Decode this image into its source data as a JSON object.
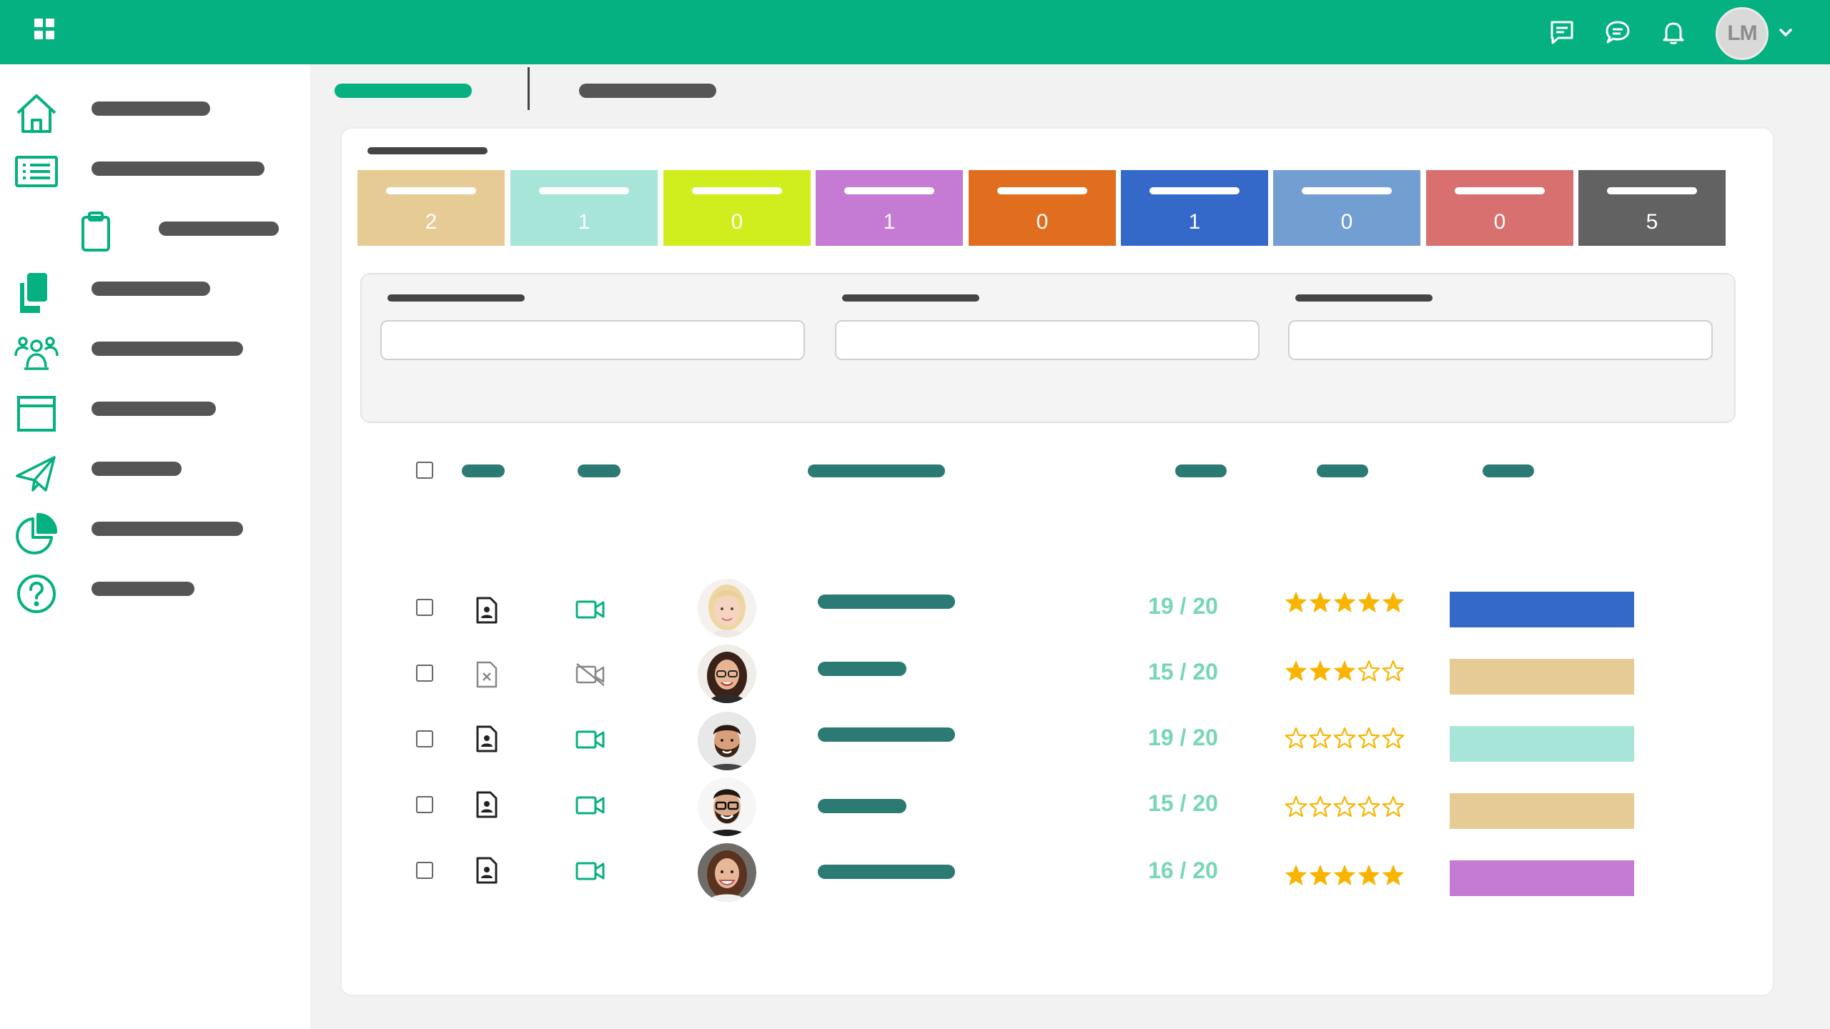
{
  "header": {
    "icons": [
      "apps-grid-icon",
      "feedback-icon",
      "chat-icon",
      "bell-icon",
      "chevron-down-icon"
    ],
    "avatar_initials": "LM",
    "brand_color": "#05b081"
  },
  "sidebar": {
    "items": [
      {
        "icon": "home-icon",
        "label": ""
      },
      {
        "icon": "list-icon",
        "label": ""
      },
      {
        "icon": "clipboard-icon",
        "label": ""
      },
      {
        "icon": "copy-icon",
        "label": ""
      },
      {
        "icon": "team-icon",
        "label": ""
      },
      {
        "icon": "browser-window-icon",
        "label": ""
      },
      {
        "icon": "send-icon",
        "label": ""
      },
      {
        "icon": "pie-chart-icon",
        "label": ""
      },
      {
        "icon": "help-icon",
        "label": ""
      }
    ]
  },
  "tabs": [
    {
      "label": "",
      "active": true
    },
    {
      "label": "",
      "active": false
    }
  ],
  "card": {
    "title": "",
    "statuses": [
      {
        "label": "",
        "count": "2",
        "color": "#e6cb95"
      },
      {
        "label": "",
        "count": "1",
        "color": "#a7e5d8"
      },
      {
        "label": "",
        "count": "0",
        "color": "#d0ed1e"
      },
      {
        "label": "",
        "count": "1",
        "color": "#c57ad3"
      },
      {
        "label": "",
        "count": "0",
        "color": "#e06e1e"
      },
      {
        "label": "",
        "count": "1",
        "color": "#3469ca"
      },
      {
        "label": "",
        "count": "0",
        "color": "#739ed2"
      },
      {
        "label": "",
        "count": "0",
        "color": "#d97070"
      },
      {
        "label": "",
        "count": "5",
        "color": "#626262"
      }
    ],
    "filters": [
      {
        "label": "",
        "value": ""
      },
      {
        "label": "",
        "value": ""
      },
      {
        "label": "",
        "value": ""
      }
    ],
    "table": {
      "headers": [
        "",
        "",
        "",
        "",
        "",
        ""
      ],
      "rows": [
        {
          "document": "resume-icon",
          "video": "video-camera-icon",
          "name": "",
          "score": "19 / 20",
          "rating": 5,
          "status_color": "#3469ca",
          "avatar": "blonde"
        },
        {
          "document": "document-missing-icon",
          "video": "video-off-icon",
          "name": "",
          "score": "15 / 20",
          "rating": 3,
          "status_color": "#e6cb95",
          "avatar": "brunette-glasses"
        },
        {
          "document": "resume-icon",
          "video": "video-camera-icon",
          "name": "",
          "score": "19 / 20",
          "rating": 0,
          "status_color": "#a7e5d8",
          "avatar": "bearded"
        },
        {
          "document": "resume-icon",
          "video": "video-camera-icon",
          "name": "",
          "score": "15 / 20",
          "rating": 0,
          "status_color": "#e6cb95",
          "avatar": "glasses-beard"
        },
        {
          "document": "resume-icon",
          "video": "video-camera-icon",
          "name": "",
          "score": "16 / 20",
          "rating": 5,
          "status_color": "#c57ad3",
          "avatar": "smiling-woman"
        }
      ]
    }
  }
}
